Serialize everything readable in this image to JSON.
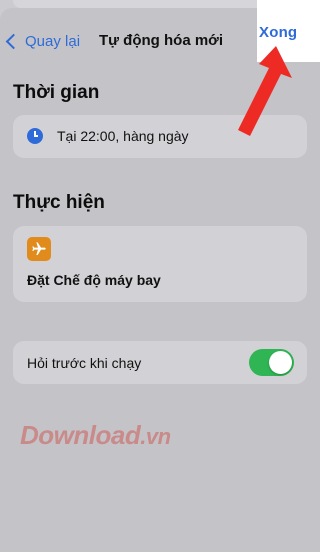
{
  "nav": {
    "back_label": "Quay lại",
    "title": "Tự động hóa mới",
    "done_label": "Xong"
  },
  "sections": {
    "time": {
      "title": "Thời gian",
      "value": "Tại 22:00, hàng ngày"
    },
    "action": {
      "title": "Thực hiện",
      "label": "Đặt Chế độ máy bay"
    }
  },
  "ask_before_run": {
    "label": "Hỏi trước khi chạy",
    "enabled": true
  },
  "watermark": {
    "text": "Download",
    "suffix": ".vn"
  },
  "colors": {
    "accent": "#2f6bd8",
    "toggle_on": "#2fb553",
    "airplane_icon_bg": "#e08b1b",
    "arrow": "#ee2a24"
  },
  "icons": {
    "back": "chevron-left-icon",
    "clock": "clock-icon",
    "airplane": "airplane-icon",
    "annotation": "red-arrow-icon"
  }
}
